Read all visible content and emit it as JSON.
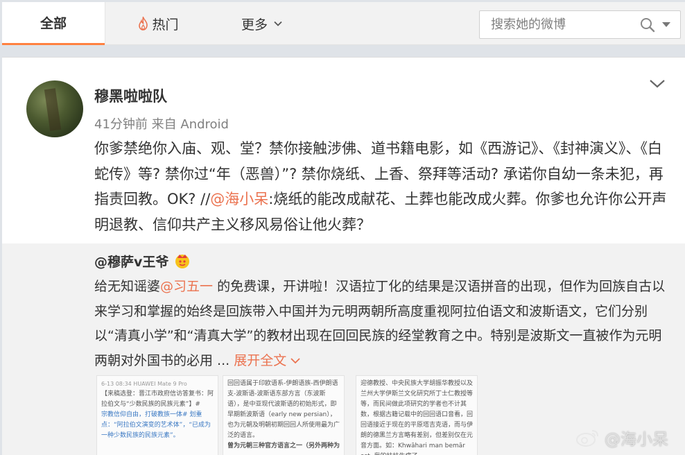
{
  "tabs": {
    "all": "全部",
    "hot": "热门",
    "more": "更多"
  },
  "search": {
    "placeholder": "搜索她的微博"
  },
  "post": {
    "author": "穆黑啦啦队",
    "time": "41分钟前",
    "source_prefix": "来自",
    "source": "Android",
    "text_before_mention": "你爹禁绝你入庙、观、堂？禁你接触涉佛、道书籍电影，如《西游记》、《封神演义》、《白蛇传》等? 禁你过“年（恶兽）”? 禁你烧纸、上香、祭拜等活动? 承诺你自幼一条未犯，再指责回教。OK? //",
    "mention": "@海小呆",
    "text_after_mention": ":烧纸的能改成献花、土葬也能改成火葬。你爹也允许你公开声明退教、信仰共产主义移风易俗让他火葬？"
  },
  "repost": {
    "author": "@穆萨v王爷",
    "text_start": "给无知谣婆",
    "mention": "@习五一",
    "text_rest": " 的免费课，开讲啦！汉语拉丁化的结果是汉语拼音的出现，但作为回族自古以来学习和掌握的始终是回族带入中国并为元明两朝所高度重视阿拉伯语文和波斯语文，它们分别以“清真小学”和“清真大学”的教材出现在回回民族的经堂教育之中。特别是波斯文一直被作为元明两朝对外国书的必用 ...",
    "expand": "展开全文",
    "thumb1": {
      "status": "6-13 08:34  HUAWEI Mate 9 Pro",
      "line1": "【来稿选登：晋江市政府信访答复书：阿拉伯文与“少数民族的民族元素”】#",
      "line2": "宗教信仰自由，打破教族一体# 划重点：“阿拉伯文演变的艺术体”，“已成为一种少数民族的民族元素”。"
    },
    "thumb2": {
      "line1": "回回语属于印欧语系-伊朗语族-西伊朗语支-波斯语-波斯语东部方言（东波斯语），是中亚现代波斯语的初始形式，即早期新波斯语（early new persian），也为元朝及明朝初期回回人所使用最为广泛的语言。",
      "line2": "曾为元朝三种官方语言之一（另外两种为"
    },
    "thumb3": {
      "line1": "迎德教授、中央民族大学胡振华教授以及兰州大学伊斯兰文化研究所丁士仁教授等等，而民间做此项研究的学者也不计其数，根据古籍记载中的回回语口音看，回回语接近于现在的平原塔吉克语，而与伊朗的德黑兰方言略有差别，但差别仅在元音方面。如：Khwāhari man bemār ast. 我的妹妹生病了。"
    }
  },
  "watermark": "@海小呆",
  "colors": {
    "accent": "#eb7350",
    "tab_underline": "#ff8140",
    "link_blue": "#3a78c3"
  },
  "icons": [
    "fire-icon",
    "chevron-down-icon",
    "search-icon",
    "dropdown-caret-icon",
    "crown-icon",
    "weibo-logo-icon"
  ]
}
